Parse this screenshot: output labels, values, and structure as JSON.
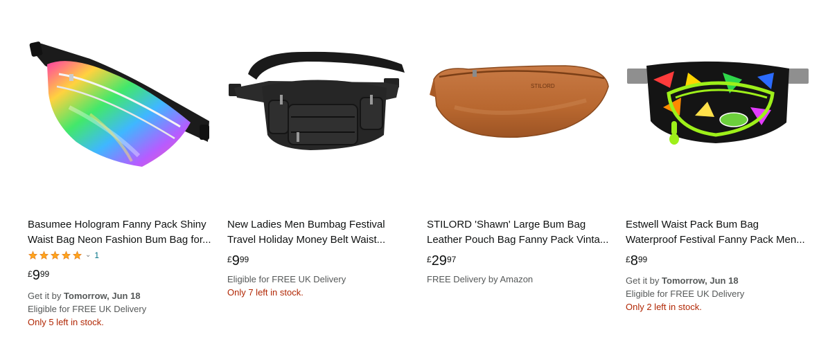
{
  "products": [
    {
      "image_alt": "Rainbow hologram fanny pack",
      "title_line1": "Basumee Hologram Fanny Pack Shiny",
      "title_line2": "Waist Bag Neon Fashion Bum Bag for...",
      "rating": {
        "stars": 5,
        "count": "1"
      },
      "price": {
        "currency": "£",
        "whole": "9",
        "fraction": "99"
      },
      "delivery_prefix": "Get it by",
      "delivery_date": "Tomorrow, Jun 18",
      "eligibility": "Eligible for FREE UK Delivery",
      "stock": "Only 5 left in stock."
    },
    {
      "image_alt": "Black leather bumbag",
      "title_line1": "New Ladies Men Bumbag Festival",
      "title_line2": "Travel Holiday Money Belt Waist...",
      "price": {
        "currency": "£",
        "whole": "9",
        "fraction": "99"
      },
      "eligibility": "Eligible for FREE UK Delivery",
      "stock": "Only 7 left in stock."
    },
    {
      "image_alt": "Tan leather bum bag",
      "title_line1": "STILORD 'Shawn' Large Bum Bag",
      "title_line2": "Leather Pouch Bag Fanny Pack Vinta...",
      "brand_stamp": "STILORD",
      "price": {
        "currency": "£",
        "whole": "29",
        "fraction": "97"
      },
      "eligibility": "FREE Delivery by Amazon"
    },
    {
      "image_alt": "Feather print waist pack",
      "title_line1": "Estwell Waist Pack Bum Bag",
      "title_line2": "Waterproof Festival Fanny Pack Men...",
      "price": {
        "currency": "£",
        "whole": "8",
        "fraction": "99"
      },
      "delivery_prefix": "Get it by",
      "delivery_date": "Tomorrow, Jun 18",
      "eligibility": "Eligible for FREE UK Delivery",
      "stock": "Only 2 left in stock."
    }
  ],
  "icons": {
    "star": "star-icon",
    "chevron": "chevron-down-icon"
  },
  "colors": {
    "star": "#ffa41c",
    "stock": "#b12704",
    "link": "#007185",
    "muted": "#565959"
  }
}
